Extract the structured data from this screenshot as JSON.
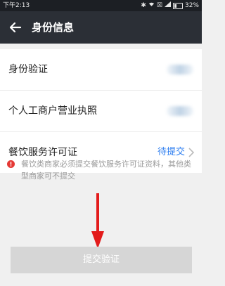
{
  "status_bar": {
    "time": "下午2:13",
    "battery": "32%",
    "icons": [
      "bluetooth-icon",
      "wifi-icon",
      "sim-icon",
      "signal-icon",
      "battery-icon"
    ]
  },
  "nav": {
    "title": "身份信息",
    "back_icon": "arrow-left-icon"
  },
  "list": {
    "items": [
      {
        "label": "身份验证"
      },
      {
        "label": "个人工商户营业执照"
      },
      {
        "label": "餐饮服务许可证",
        "status": "待提交"
      }
    ]
  },
  "notice": {
    "text": "餐饮类商家必须提交餐饮服务许可证资料，其他类型商家可不提交",
    "icon": "alert-circle-icon"
  },
  "submit": {
    "label": "提交验证"
  },
  "colors": {
    "nav_bg": "#2b2f36",
    "status_bar_bg": "#1c1f24",
    "page_bg": "#f0f0f0",
    "link_blue": "#2d7ef0",
    "alert_red": "#e53935",
    "arrow_red": "#e31b1b",
    "button_disabled": "#d6d6d6"
  }
}
